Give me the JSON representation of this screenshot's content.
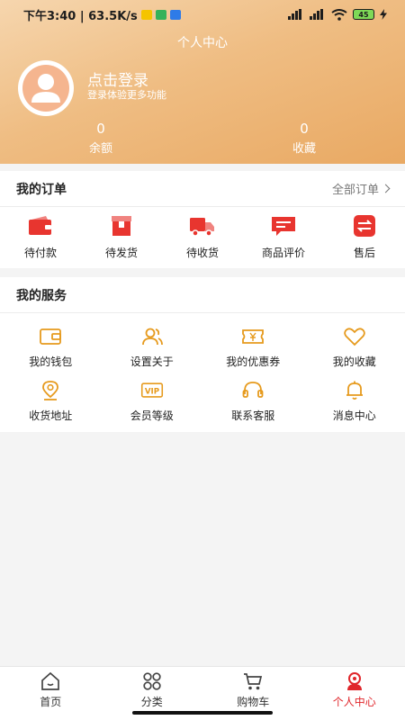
{
  "status_bar": {
    "time_speed": "下午3:40 | 63.5K/s",
    "network": "5G",
    "battery": "45"
  },
  "header": {
    "title": "个人中心",
    "login_title": "点击登录",
    "login_sub": "登录体验更多功能",
    "stats": [
      {
        "num": "0",
        "label": "余额"
      },
      {
        "num": "0",
        "label": "收藏"
      }
    ]
  },
  "orders": {
    "title": "我的订单",
    "more": "全部订单",
    "items": [
      {
        "label": "待付款",
        "icon": "wallet-icon"
      },
      {
        "label": "待发货",
        "icon": "box-icon"
      },
      {
        "label": "待收货",
        "icon": "truck-icon"
      },
      {
        "label": "商品评价",
        "icon": "comment-icon"
      },
      {
        "label": "售后",
        "icon": "exchange-icon"
      }
    ]
  },
  "services": {
    "title": "我的服务",
    "items": [
      {
        "label": "我的钱包",
        "icon": "wallet-outline-icon"
      },
      {
        "label": "设置关于",
        "icon": "users-icon"
      },
      {
        "label": "我的优惠券",
        "icon": "coupon-icon"
      },
      {
        "label": "我的收藏",
        "icon": "heart-icon"
      },
      {
        "label": "收货地址",
        "icon": "location-icon"
      },
      {
        "label": "会员等级",
        "icon": "vip-icon"
      },
      {
        "label": "联系客服",
        "icon": "headset-icon"
      },
      {
        "label": "消息中心",
        "icon": "bell-icon"
      }
    ]
  },
  "tabbar": {
    "items": [
      {
        "label": "首页",
        "icon": "home-icon"
      },
      {
        "label": "分类",
        "icon": "grid-icon"
      },
      {
        "label": "购物车",
        "icon": "cart-icon"
      },
      {
        "label": "个人中心",
        "icon": "user-icon",
        "active": true
      }
    ]
  },
  "colors": {
    "accent_red": "#e0262b",
    "accent_orange": "#e69a1d",
    "header_gradient_start": "#f6d6ae",
    "header_gradient_end": "#e9a963"
  }
}
